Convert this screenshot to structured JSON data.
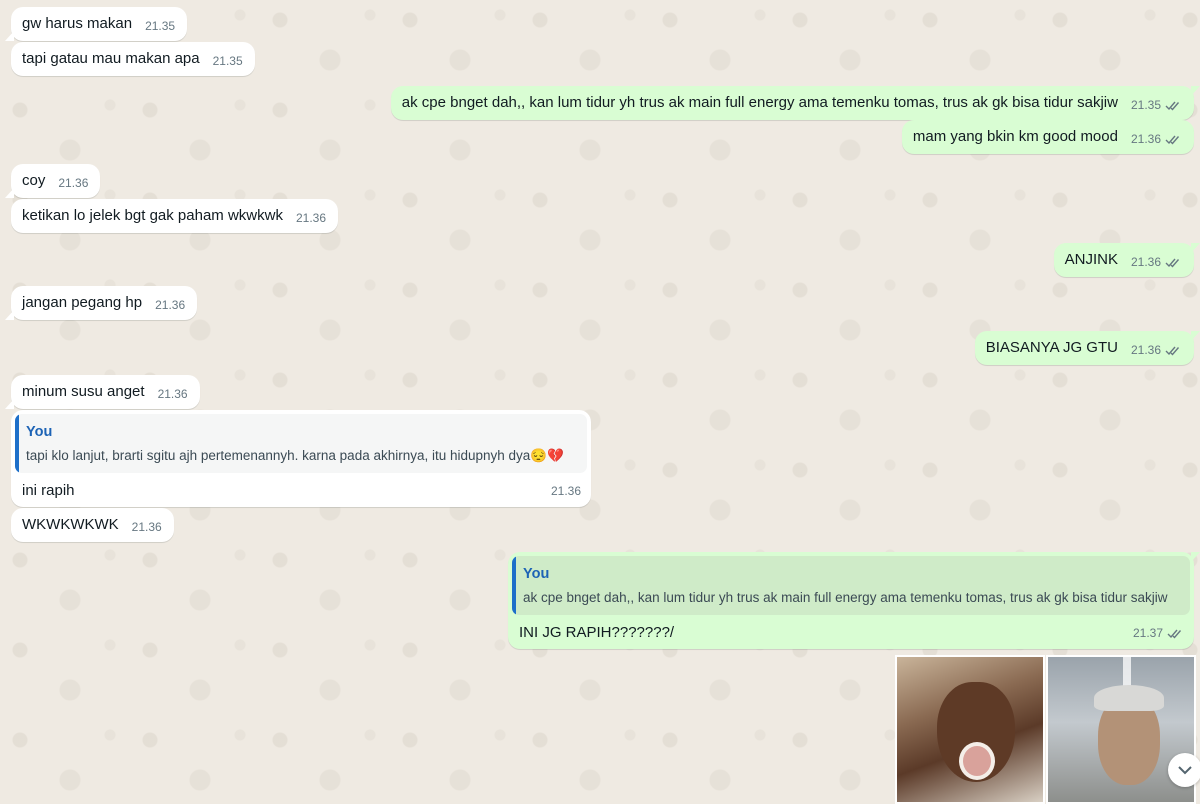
{
  "messages": [
    {
      "id": "m1",
      "text": "gw harus makan",
      "time": "21.35"
    },
    {
      "id": "m2",
      "text": "tapi gatau mau makan apa",
      "time": "21.35"
    },
    {
      "id": "m3",
      "text": "ak cpe bnget dah,, kan lum tidur yh trus ak main full energy ama temenku tomas, trus ak gk bisa tidur sakjiw",
      "time": "21.35"
    },
    {
      "id": "m4",
      "text": "mam yang bkin km good mood",
      "time": "21.36"
    },
    {
      "id": "m5",
      "text": "coy",
      "time": "21.36"
    },
    {
      "id": "m6",
      "text": "ketikan lo jelek bgt gak paham wkwkwk",
      "time": "21.36"
    },
    {
      "id": "m7",
      "text": "ANJINK",
      "time": "21.36"
    },
    {
      "id": "m8",
      "text": "jangan pegang hp",
      "time": "21.36"
    },
    {
      "id": "m9",
      "text": "BIASANYA JG GTU",
      "time": "21.36"
    },
    {
      "id": "m10",
      "text": "minum susu anget",
      "time": "21.36"
    },
    {
      "id": "m11",
      "quote_author": "You",
      "quote_text": "tapi klo lanjut, brarti sgitu ajh pertemenannyh. karna pada akhirnya, itu hidupnyh dya😔💔",
      "text": "ini rapih",
      "time": "21.36"
    },
    {
      "id": "m12",
      "text": "WKWKWKWK",
      "time": "21.36"
    },
    {
      "id": "m13",
      "quote_author": "You",
      "quote_text": "ak cpe bnget dah,, kan lum tidur yh trus ak main full energy ama temenku tomas, trus ak gk bisa tidur sakjiw",
      "text": "INI JG RAPIH???????/",
      "time": "21.37"
    }
  ],
  "colors": {
    "outgoing_bubble": "#d9fdd3",
    "incoming_bubble": "#ffffff",
    "quote_accent": "#1d6fc9",
    "read_ticks": "#667781"
  },
  "icons": {
    "read_receipt": "double-check-icon",
    "scroll_down": "chevron-down-icon"
  }
}
